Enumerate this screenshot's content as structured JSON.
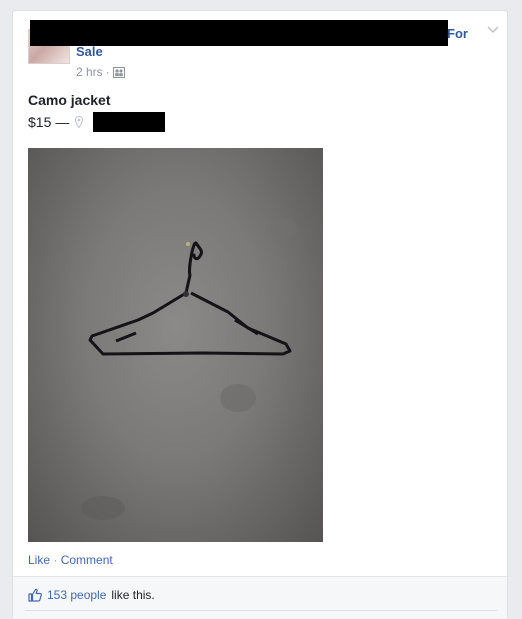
{
  "post": {
    "group_name_part1": "For",
    "group_name_part2": "Sale",
    "time": "2 hrs",
    "separator": "·",
    "privacy_icon": "members-icon",
    "options_icon": "chevron-down-icon"
  },
  "listing": {
    "title": "Camo jacket",
    "price": "$15",
    "dash": "—",
    "location_icon": "map-pin-icon"
  },
  "photo": {
    "subject_icon": "clothes-hanger"
  },
  "actions": {
    "like": "Like",
    "separator": "·",
    "comment": "Comment"
  },
  "likes": {
    "icon": "thumbs-up-icon",
    "count_text": "153 people",
    "suffix": "like this."
  },
  "colors": {
    "link": "#365899",
    "muted": "#90949c",
    "action_link": "#4267b2",
    "background": "#e9ebee"
  }
}
